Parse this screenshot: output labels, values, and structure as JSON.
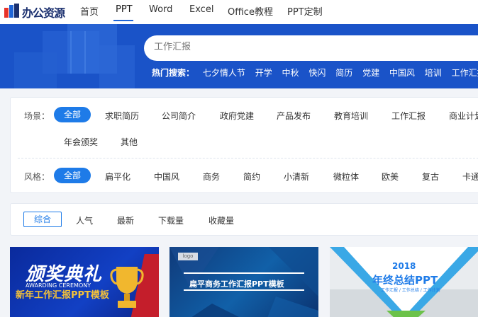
{
  "logo": {
    "text": "办公资源"
  },
  "nav": {
    "items": [
      {
        "label": "首页"
      },
      {
        "label": "PPT"
      },
      {
        "label": "Word"
      },
      {
        "label": "Excel"
      },
      {
        "label": "Office教程"
      },
      {
        "label": "PPT定制"
      }
    ]
  },
  "search": {
    "placeholder": "工作汇报"
  },
  "hot": {
    "label": "热门搜索：",
    "items": [
      "七夕情人节",
      "开学",
      "中秋",
      "快闪",
      "简历",
      "党建",
      "中国风",
      "培训",
      "工作汇报"
    ]
  },
  "filters": {
    "scene_label": "场景：",
    "scene": [
      "全部",
      "求职简历",
      "公司简介",
      "政府党建",
      "产品发布",
      "教育培训",
      "工作汇报",
      "商业计划",
      "年会颁奖",
      "其他"
    ],
    "style_label": "风格：",
    "style": [
      "全部",
      "扁平化",
      "中国风",
      "商务",
      "简约",
      "小清新",
      "微粒体",
      "欧美",
      "复古",
      "卡通"
    ]
  },
  "sort": {
    "items": [
      "综合",
      "人气",
      "最新",
      "下载量",
      "收藏量"
    ]
  },
  "cards": [
    {
      "title": "颁奖典礼",
      "subtitle": "AWARDING CEREMONY",
      "line": "新年工作汇报PPT模板"
    },
    {
      "logo": "logo",
      "title": "扁平商务工作汇报PPT模板"
    },
    {
      "year": "2018",
      "title": "年终总结PPT",
      "sub": "工作汇报 / 工作总结 / 工作计划"
    }
  ],
  "colors": {
    "brand": "#1e7be8",
    "banner": "#1a53c8"
  }
}
